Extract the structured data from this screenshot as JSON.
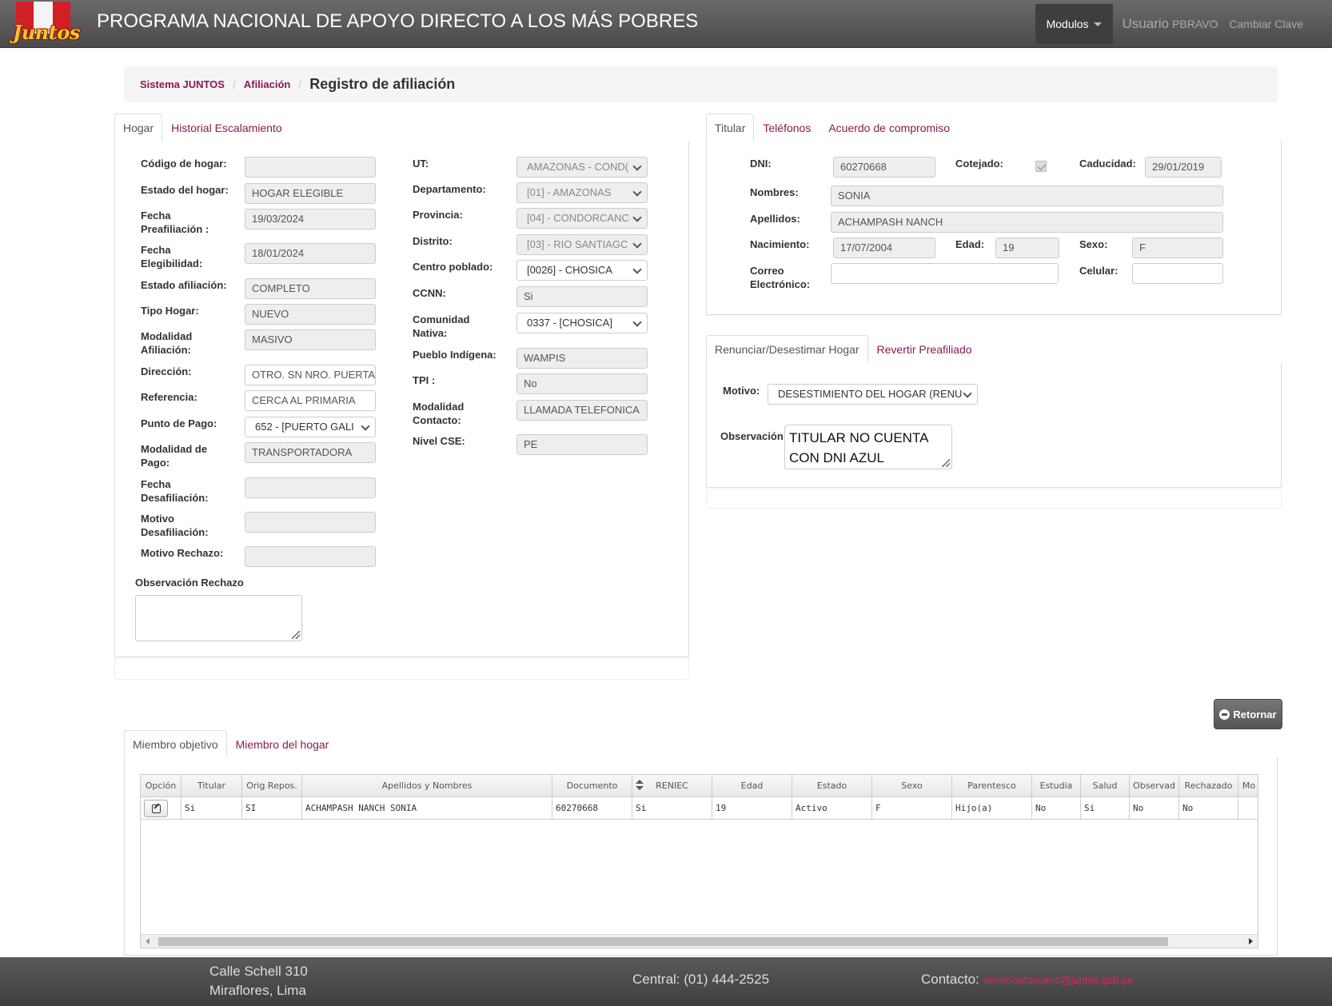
{
  "navbar": {
    "logo_text": "Juntos",
    "title": "PROGRAMA NACIONAL DE APOYO DIRECTO A LOS MÁS POBRES",
    "modulos": "Modulos",
    "user_label": "Usuario",
    "user_name": "PBRAVO",
    "change_password": "Cambiar Clave"
  },
  "breadcrumb": {
    "items": [
      "Sistema JUNTOS",
      "Afiliación"
    ],
    "active": "Registro de afiliación"
  },
  "hogar_tabs": [
    "Hogar",
    "Historial Escalamiento"
  ],
  "hogar": {
    "codigo_label": "Código de hogar:",
    "codigo": "",
    "estado_label": "Estado del hogar:",
    "estado": "HOGAR ELEGIBLE",
    "fecha_pre_label": "Fecha Preafiliación :",
    "fecha_pre": "19/03/2024",
    "fecha_eleg_label": "Fecha Elegibilidad:",
    "fecha_eleg": "18/01/2024",
    "estado_afil_label": "Estado afiliación:",
    "estado_afil": "COMPLETO",
    "tipo_label": "Tipo Hogar:",
    "tipo": "NUEVO",
    "modalidad_afil_label": "Modalidad Afiliación:",
    "modalidad_afil": "MASIVO",
    "direccion_label": "Dirección:",
    "direccion": "OTRO. SN NRO. PUERTA",
    "referencia_label": "Referencia:",
    "referencia": "CERCA AL PRIMARIA",
    "punto_pago_label": "Punto de Pago:",
    "punto_pago": "652 - [PUERTO GALI",
    "modalidad_pago_label": "Modalidad de Pago:",
    "modalidad_pago": "TRANSPORTADORA",
    "fecha_desaf_label": "Fecha Desafiliación:",
    "fecha_desaf": "",
    "motivo_desaf_label": "Motivo Desafiliación:",
    "motivo_desaf": "",
    "motivo_rechazo_label": "Motivo Rechazo:",
    "motivo_rechazo": "",
    "obs_rechazo_label": "Observación Rechazo",
    "ut_label": "UT:",
    "ut": "AMAZONAS - COND(",
    "dep_label": "Departamento:",
    "dep": "[01] - AMAZONAS",
    "prov_label": "Provincia:",
    "prov": "[04] - CONDORCANC",
    "dist_label": "Distrito:",
    "dist": "[03] - RIO SANTIAGC",
    "centro_label": "Centro poblado:",
    "centro": "[0026] - CHOSICA",
    "ccnn_label": "CCNN:",
    "ccnn": "Si",
    "comunidad_label": "Comunidad Nativa:",
    "comunidad": "0337 - [CHOSICA]",
    "pueblo_label": "Pueblo Indígena:",
    "pueblo": "WAMPIS",
    "tpi_label": "TPI :",
    "tpi": "No",
    "modalidad_contacto_label": "Modalidad Contacto:",
    "modalidad_contacto": "LLAMADA TELEFONICA",
    "nivel_cse_label": "Nivel CSE:",
    "nivel_cse": "PE"
  },
  "titular_tabs": [
    "Titular",
    "Teléfonos",
    "Acuerdo de compromiso"
  ],
  "titular": {
    "dni_label": "DNI:",
    "dni": "60270668",
    "cotejado_label": "Cotejado:",
    "caducidad_label": "Caducidad:",
    "caducidad": "29/01/2019",
    "nombres_label": "Nombres:",
    "nombres": "SONIA",
    "apellidos_label": "Apellidos:",
    "apellidos": "ACHAMPASH NANCH",
    "nacimiento_label": "Nacimiento:",
    "nacimiento": "17/07/2004",
    "edad_label": "Edad:",
    "edad": "19",
    "sexo_label": "Sexo:",
    "sexo": "F",
    "correo_label": "Correo Electrónico:",
    "correo": "",
    "celular_label": "Celular:",
    "celular": ""
  },
  "renuncia_tabs": [
    "Renunciar/Desestimar Hogar",
    "Revertir Preafiliado"
  ],
  "renuncia": {
    "motivo_label": "Motivo:",
    "motivo": "DESESTIMIENTO DEL HOGAR (RENU",
    "obs_label": "Observación",
    "obs": "TITULAR NO CUENTA CON DNI AZUL"
  },
  "return_button": "Retornar",
  "miembro_tabs": [
    "Miembro objetivo",
    "Miembro del hogar"
  ],
  "grid": {
    "columns": [
      "Opción",
      "Titular",
      "Orig Repos.",
      "Apellidos y Nombres",
      "Documento",
      "RENIEC",
      "Edad",
      "Estado",
      "Sexo",
      "Parentesco",
      "Estudia",
      "Salud",
      "Observad",
      "Rechazado",
      "Mo"
    ],
    "rows": [
      [
        "",
        "Si",
        "SI",
        "ACHAMPASH NANCH SONIA",
        "60270668",
        "Si",
        "19",
        "Activo",
        "F",
        "Hijo(a)",
        "No",
        "Si",
        "No",
        "No",
        ""
      ]
    ]
  },
  "footer": {
    "address1": "Calle Schell 310",
    "address2": "Miraflores, Lima",
    "central": "Central: (01) 444-2525",
    "contact_label": "Contacto:",
    "contact_email": "servicioalusuario@juntos.gob.pe"
  },
  "colors": {
    "link": "#8b1a4a",
    "navbar": "#555555",
    "footer": "#4a4a4a",
    "email": "#e0245e"
  }
}
